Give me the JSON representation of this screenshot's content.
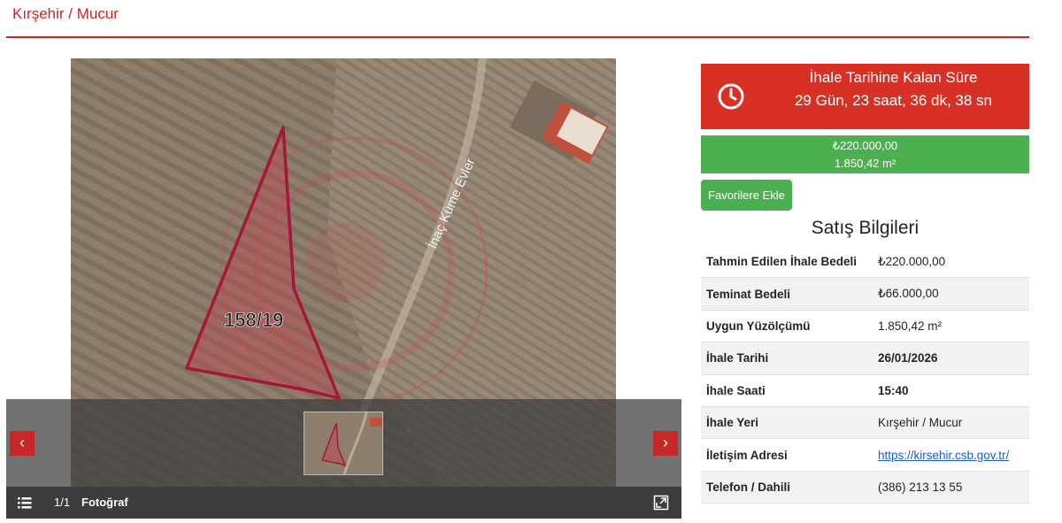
{
  "header": {
    "title": "Kırşehir / Mucur"
  },
  "gallery": {
    "photo_parcel_label": "158/19",
    "photo_road_label": "İnaç Küme Evler",
    "counter": "1/1",
    "label": "Fotoğraf",
    "prev_label": "‹",
    "next_label": "›"
  },
  "countdown": {
    "title": "İhale Tarihine Kalan Süre",
    "value": "29 Gün, 23 saat, 36 dk, 38 sn"
  },
  "price": {
    "amount": "₺220.000,00",
    "area": "1.850,42 m²"
  },
  "favorite_label": "Favorilere Ekle",
  "sales_info": {
    "title": "Satış Bilgileri",
    "rows": [
      {
        "label": "Tahmin Edilen İhale Bedeli",
        "value": "₺220.000,00"
      },
      {
        "label": "Teminat Bedeli",
        "value": "₺66.000,00"
      },
      {
        "label": "Uygun Yüzölçümü",
        "value": "1.850,42 m²"
      },
      {
        "label": "İhale Tarihi",
        "value": "26/01/2026"
      },
      {
        "label": "İhale Saati",
        "value": "15:40"
      },
      {
        "label": "İhale Yeri",
        "value": "Kırşehir / Mucur"
      },
      {
        "label": "İletişim Adresi",
        "value": "https://kirsehir.csb.gov.tr/"
      },
      {
        "label": "Telefon / Dahili",
        "value": "(386) 213 13 55"
      }
    ]
  },
  "colors": {
    "accent": "#c62828",
    "countdown_bg": "#d93025",
    "success": "#4caf50"
  },
  "icons": [
    "clock-icon",
    "list-icon",
    "expand-icon",
    "chevron-left-icon",
    "chevron-right-icon"
  ]
}
